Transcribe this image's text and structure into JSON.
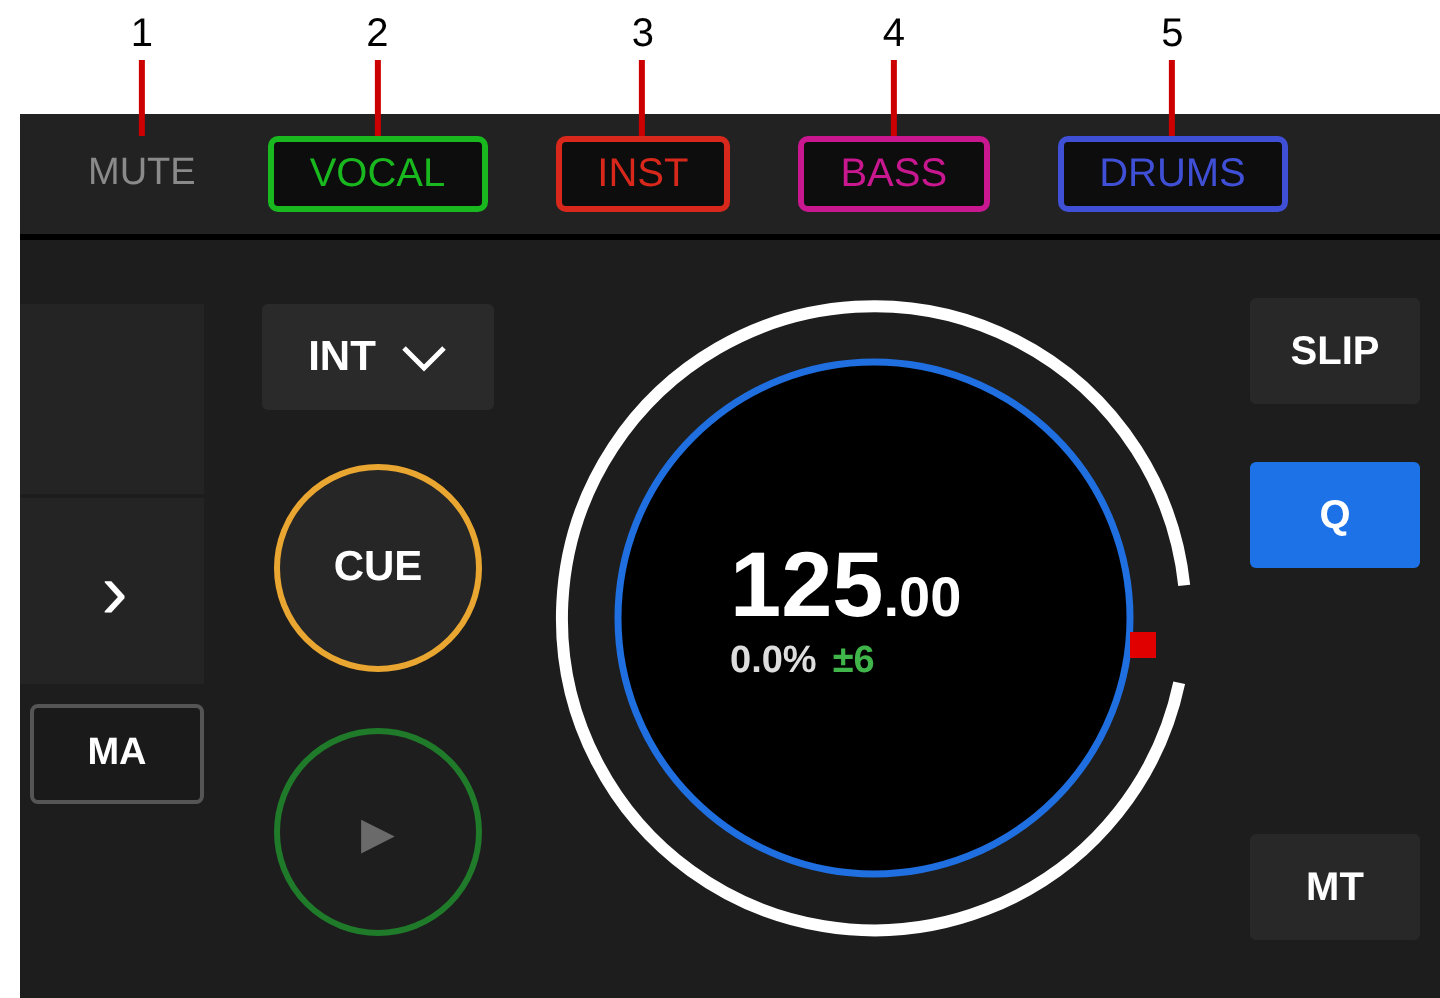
{
  "stems": [
    {
      "kind": "mute",
      "label": "MUTE",
      "callout": "1"
    },
    {
      "kind": "stem",
      "label": "VOCAL",
      "color": "#19b81f",
      "callout": "2"
    },
    {
      "kind": "stem",
      "label": "INST",
      "color": "#d8281c",
      "callout": "3"
    },
    {
      "kind": "stem",
      "label": "BASS",
      "color": "#c9178f",
      "callout": "4"
    },
    {
      "kind": "stem",
      "label": "DRUMS",
      "color": "#3f4fd6",
      "callout": "5"
    }
  ],
  "left_panel": {
    "next": "›",
    "master": "MA"
  },
  "transport": {
    "loop_mode": "INT",
    "cue": "CUE",
    "play": "▶"
  },
  "jog": {
    "bpm": "125",
    "bpm_decimals": ".00",
    "pitch": "0.0%",
    "range": "±6"
  },
  "right_buttons": [
    {
      "label": "SLIP",
      "on": false
    },
    {
      "label": "Q",
      "on": true
    },
    {
      "label": "MT",
      "on": false
    }
  ]
}
